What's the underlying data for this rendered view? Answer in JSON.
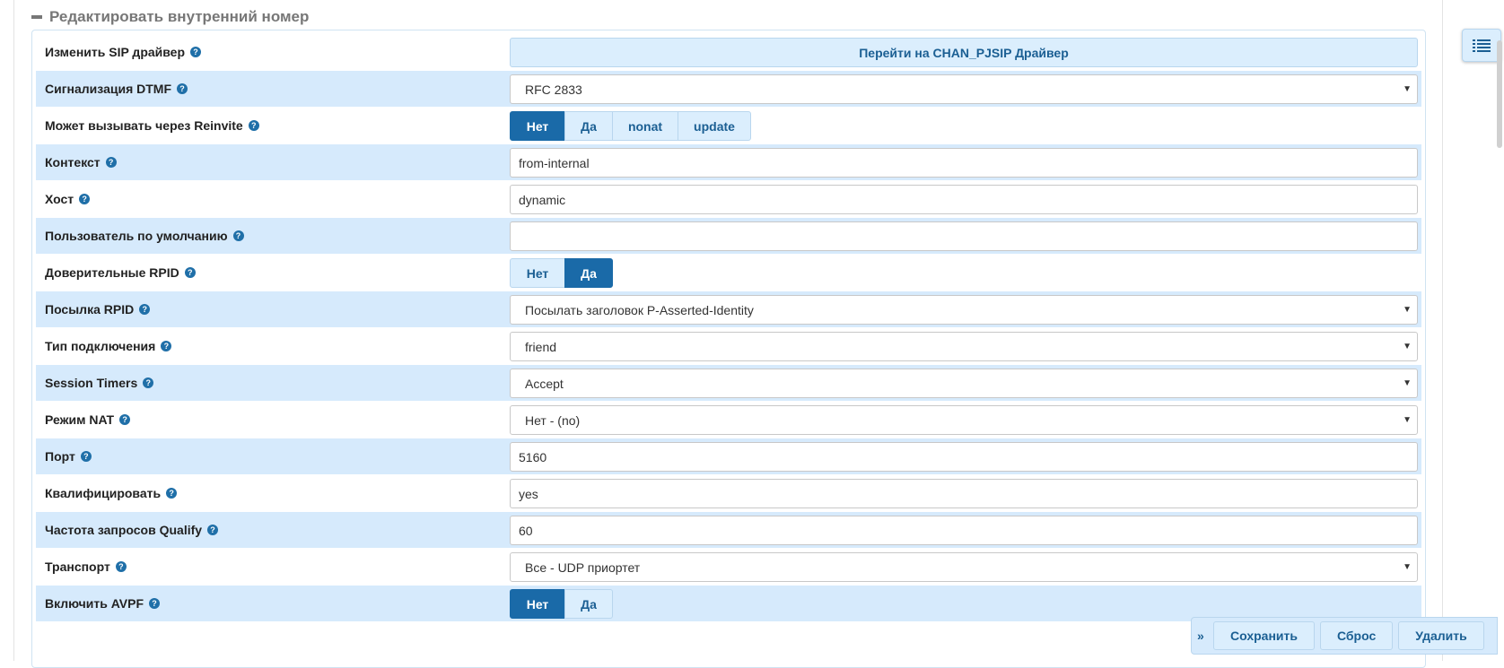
{
  "section": {
    "title": "Редактировать внутренний номер"
  },
  "rows": [
    {
      "label": "Изменить SIP драйвер",
      "button": "Перейти на CHAN_PJSIP Драйвер"
    },
    {
      "label": "Сигнализация DTMF",
      "value": "RFC 2833"
    },
    {
      "label": "Может вызывать через Reinvite",
      "options": [
        "Нет",
        "Да",
        "nonat",
        "update"
      ],
      "selected": "Нет"
    },
    {
      "label": "Контекст",
      "value": "from-internal"
    },
    {
      "label": "Хост",
      "value": "dynamic"
    },
    {
      "label": "Пользователь по умолчанию",
      "value": ""
    },
    {
      "label": "Доверительные RPID",
      "options": [
        "Нет",
        "Да"
      ],
      "selected": "Да"
    },
    {
      "label": "Посылка RPID",
      "value": "Посылать заголовок P-Asserted-Identity"
    },
    {
      "label": "Тип подключения",
      "value": "friend"
    },
    {
      "label": "Session Timers",
      "value": "Accept"
    },
    {
      "label": "Режим NAT",
      "value": "Нет - (no)"
    },
    {
      "label": "Порт",
      "value": "5160"
    },
    {
      "label": "Квалифицировать",
      "value": "yes"
    },
    {
      "label": "Частота запросов Qualify",
      "value": "60"
    },
    {
      "label": "Транспорт",
      "value": "Все - UDP приортет"
    },
    {
      "label": "Включить AVPF",
      "options": [
        "Нет",
        "Да"
      ],
      "selected": "Нет"
    }
  ],
  "actions": {
    "save": "Сохранить",
    "reset": "Сброс",
    "delete": "Удалить"
  },
  "icons": {
    "help": "question-circle-icon",
    "caret": "caret-down-icon",
    "list": "list-icon",
    "collapse": "minus-icon",
    "chevron": "double-chevron-right-icon"
  },
  "colors": {
    "accent": "#1a6aa8",
    "row_alt": "#d6eafc",
    "button_bg": "#dbeefd"
  }
}
